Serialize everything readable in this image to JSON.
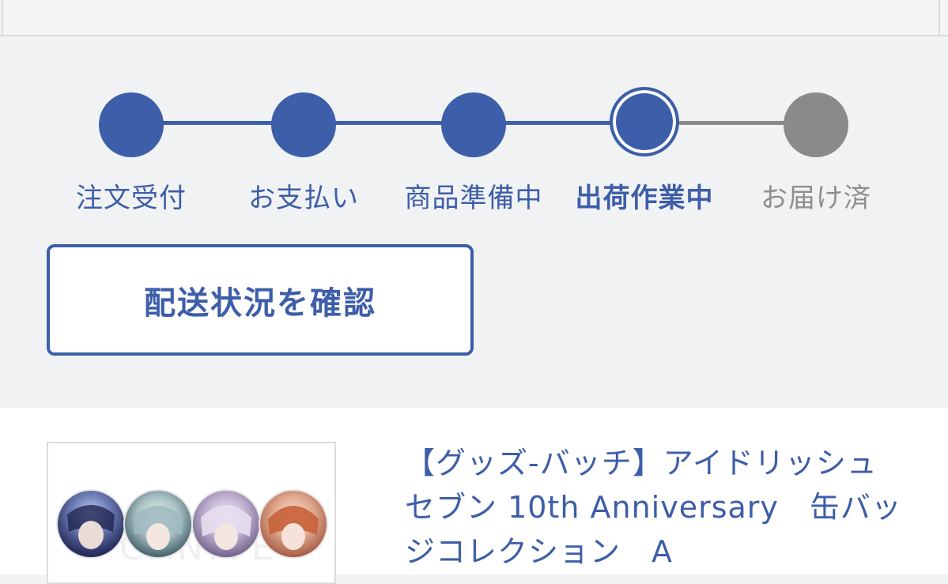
{
  "colors": {
    "accent": "#3d5ea8",
    "inactive": "#8a8a8a",
    "inactive_text": "#8f8f8f"
  },
  "steps": [
    {
      "label": "注文受付",
      "state": "done"
    },
    {
      "label": "お支払い",
      "state": "done"
    },
    {
      "label": "商品準備中",
      "state": "done"
    },
    {
      "label": "出荷作業中",
      "state": "current"
    },
    {
      "label": "お届け済",
      "state": "pending"
    }
  ],
  "actions": {
    "confirm_shipping_label": "配送状況を確認"
  },
  "product": {
    "title": "【グッズ-バッチ】アイドリッシュセブン 10th Anniversary　缶バッジコレクション　A"
  }
}
